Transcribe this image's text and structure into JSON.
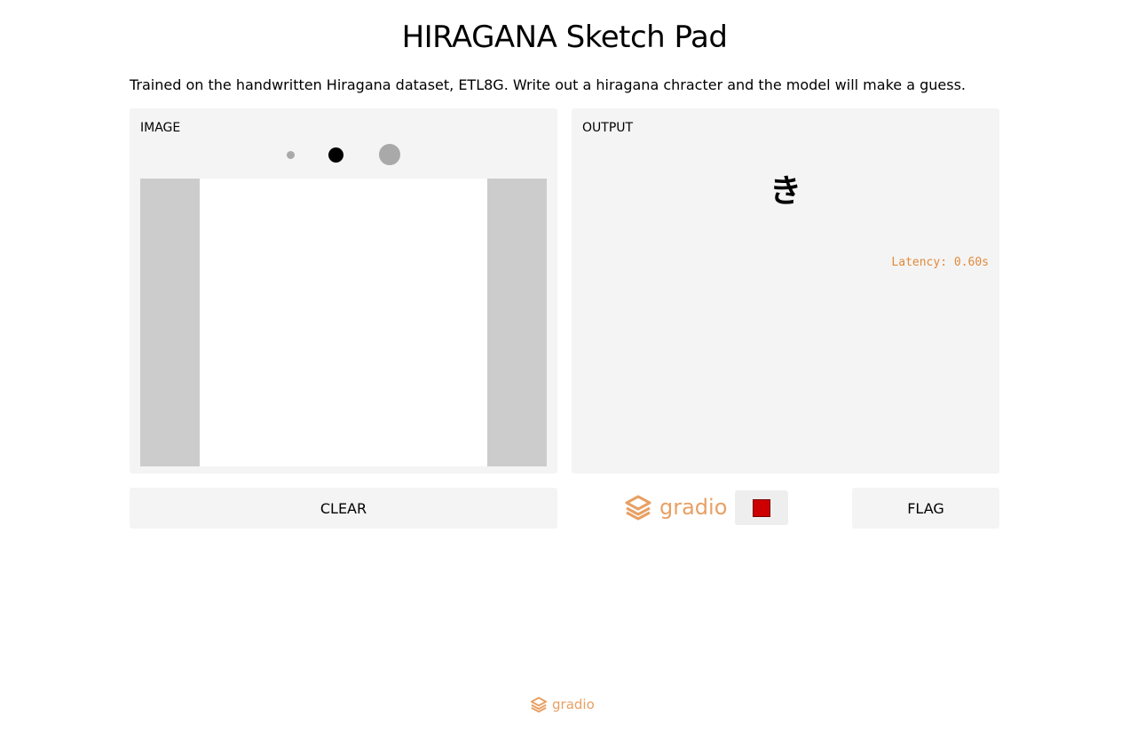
{
  "header": {
    "title": "HIRAGANA Sketch Pad",
    "description": "Trained on the handwritten Hiragana dataset, ETL8G. Write out a hiragana chracter and the model will make a guess."
  },
  "input_panel": {
    "label": "IMAGE",
    "brush_sizes": [
      "small",
      "medium",
      "large"
    ],
    "selected_brush": "medium"
  },
  "output_panel": {
    "label": "OUTPUT",
    "prediction": "き",
    "latency": "Latency: 0.60s"
  },
  "buttons": {
    "clear_label": "CLEAR",
    "flag_label": "FLAG"
  },
  "branding": {
    "name": "gradio",
    "footer_name": "gradio"
  },
  "colors": {
    "accent": "#e8a064",
    "latency": "#e08a3b",
    "stop": "#cc0000",
    "panel_bg": "#f4f4f4",
    "canvas_margin": "#cccccc"
  },
  "icons": {
    "logo": "gradio-logo-icon",
    "stop": "stop-icon"
  }
}
